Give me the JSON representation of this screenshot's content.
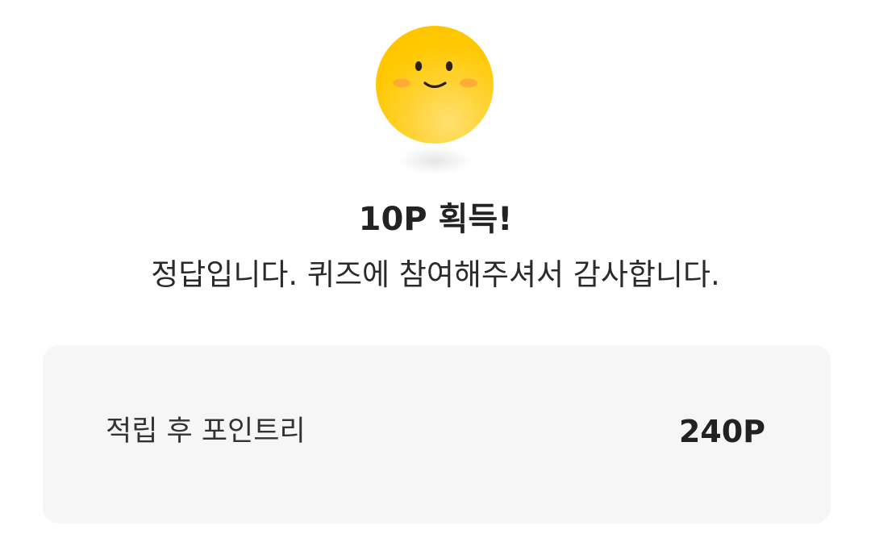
{
  "result": {
    "icon": "smiling-face-icon",
    "title": "10P 획득!",
    "message": "정답입니다. 퀴즈에 참여해주셔서 감사합니다."
  },
  "points_card": {
    "label": "적립 후 포인트리",
    "value": "240P"
  },
  "colors": {
    "face": "#ffc800",
    "card_background": "#f6f6f6",
    "text": "#222222"
  }
}
